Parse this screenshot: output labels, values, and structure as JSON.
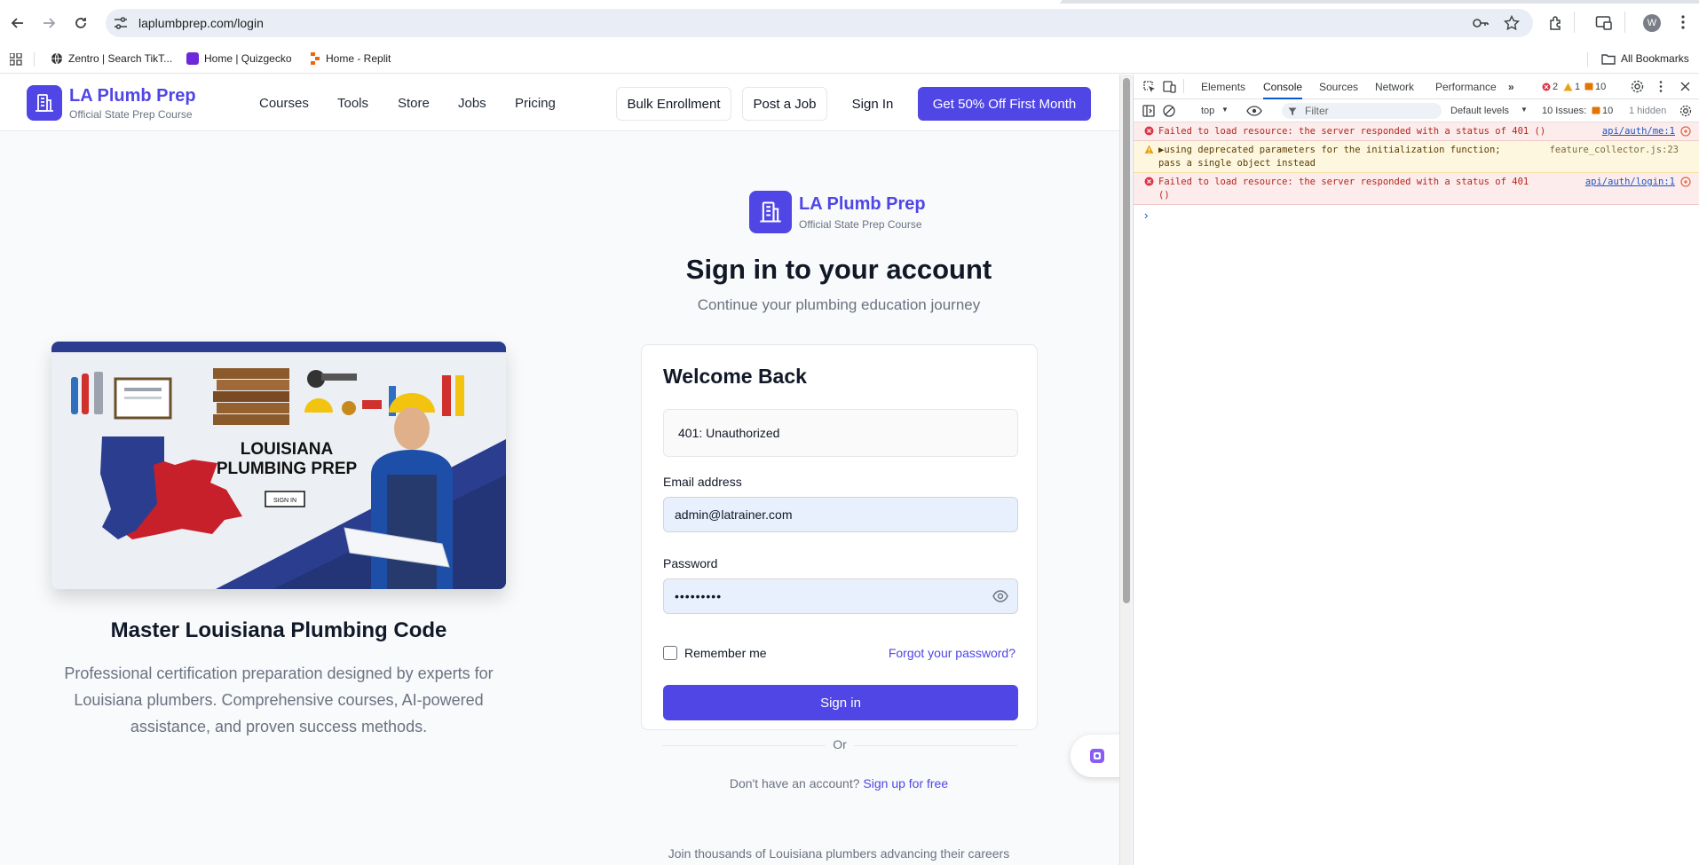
{
  "browser": {
    "url": "laplumbprep.com/login",
    "profile_initial": "W",
    "bookmarks": [
      {
        "label": "Zentro | Search TikT...",
        "color": "#333333"
      },
      {
        "label": "Home | Quizgecko",
        "color": "#6d28d9"
      },
      {
        "label": "Home - Replit",
        "color": "#f26207"
      }
    ],
    "all_bookmarks_label": "All Bookmarks"
  },
  "site": {
    "brand_title": "LA Plumb Prep",
    "brand_subtitle": "Official State Prep Course",
    "nav": [
      "Courses",
      "Tools",
      "Store",
      "Jobs",
      "Pricing"
    ],
    "bulk_enrollment": "Bulk Enrollment",
    "post_job": "Post a Job",
    "sign_in": "Sign In",
    "cta": "Get 50% Off First Month",
    "accent": "#4f46e5"
  },
  "hero": {
    "image_text_line1": "LOUISIANA",
    "image_text_line2": "PLUMBING PREP",
    "image_button": "SIGN IN",
    "heading": "Master Louisiana Plumbing Code",
    "description": "Professional certification preparation designed by experts for Louisiana plumbers. Comprehensive courses, AI-powered assistance, and proven success methods."
  },
  "login": {
    "brand_title": "LA Plumb Prep",
    "brand_subtitle": "Official State Prep Course",
    "title": "Sign in to your account",
    "subtitle": "Continue your plumbing education journey",
    "card_title": "Welcome Back",
    "error": "401: Unauthorized",
    "email_label": "Email address",
    "email_value": "admin@latrainer.com",
    "password_label": "Password",
    "password_mask": "•••••••••",
    "remember_label": "Remember me",
    "forgot_label": "Forgot your password?",
    "submit_label": "Sign in",
    "or_label": "Or",
    "no_account": "Don't have an account?",
    "signup_label": "Sign up for free",
    "join_text": "Join thousands of Louisiana plumbers advancing their careers"
  },
  "devtools": {
    "tabs": [
      "Elements",
      "Console",
      "Sources",
      "Network",
      "Performance"
    ],
    "active_tab": "Console",
    "error_count": "2",
    "warning_count": "1",
    "issue_count": "10",
    "context": "top",
    "filter_placeholder": "Filter",
    "levels": "Default levels",
    "issues_label": "10 Issues:",
    "issues_count": "10",
    "hidden_label": "1 hidden",
    "messages": [
      {
        "level": "error",
        "text": "Failed to load resource: the server responded with a status of 401 ()",
        "source": "api/auth/me:1"
      },
      {
        "level": "warning",
        "text_line1": "▶using deprecated parameters for the initialization function;",
        "text_line2": "pass a single object instead",
        "source": "feature_collector.js:23"
      },
      {
        "level": "error",
        "text_line1": "Failed to load resource: the server responded with a status of 401",
        "text_line2": "()",
        "source": "api/auth/login:1"
      }
    ],
    "prompt": "›"
  }
}
